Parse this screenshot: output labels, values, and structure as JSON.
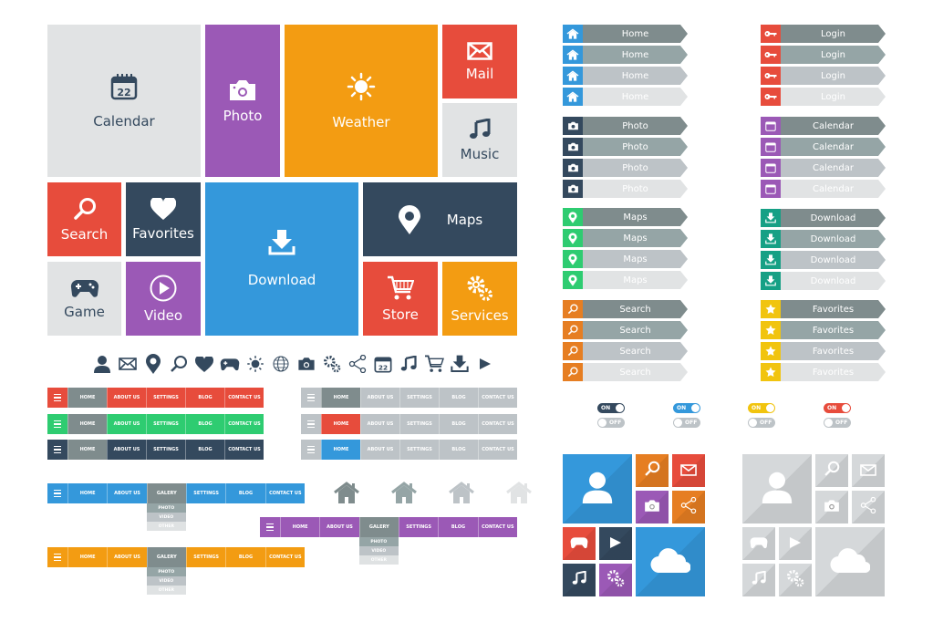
{
  "tiles": {
    "calendar": {
      "label": "Calendar",
      "day": "22"
    },
    "photo": {
      "label": "Photo"
    },
    "weather": {
      "label": "Weather"
    },
    "mail": {
      "label": "Mail"
    },
    "music": {
      "label": "Music"
    },
    "search": {
      "label": "Search"
    },
    "favorites": {
      "label": "Favorites"
    },
    "download": {
      "label": "Download"
    },
    "maps": {
      "label": "Maps"
    },
    "game": {
      "label": "Game"
    },
    "video": {
      "label": "Video"
    },
    "store": {
      "label": "Store"
    },
    "services": {
      "label": "Services"
    }
  },
  "icon_row": [
    "user-icon",
    "mail-icon",
    "map-pin-icon",
    "search-icon",
    "heart-icon",
    "gamepad-icon",
    "sun-icon",
    "globe-icon",
    "camera-icon",
    "gears-icon",
    "share-icon",
    "calendar-icon",
    "music-icon",
    "cart-icon",
    "download-icon",
    "play-icon"
  ],
  "calendar_day": "22",
  "nav": {
    "items": [
      "HOME",
      "ABOUT US",
      "SETTINGS",
      "BLOG",
      "CONTACT US"
    ],
    "items_gallery": [
      "HOME",
      "ABOUT US",
      "GALERY",
      "SETTINGS",
      "BLOG",
      "CONTACT US"
    ],
    "dropdown": [
      "PHOTO",
      "VIDEO",
      "OTHER"
    ]
  },
  "colors": {
    "red": "#e74c3c",
    "green": "#2ecc71",
    "navy": "#34495e",
    "blue": "#3498db",
    "purple": "#9b59b6",
    "orange": "#f39c12",
    "gray": "#bdc3c7",
    "darkgray": "#7f8c8d",
    "lightgray": "#e1e3e4",
    "teal": "#16a085",
    "darkorange": "#e67e22",
    "yellow": "#f1c40f"
  },
  "arrow_buttons": {
    "home": "Home",
    "photo": "Photo",
    "maps": "Maps",
    "search": "Search",
    "login": "Login",
    "calendar": "Calendar",
    "download": "Download",
    "favorites": "Favorites"
  },
  "toggles": {
    "on": "ON",
    "off": "OFF"
  }
}
